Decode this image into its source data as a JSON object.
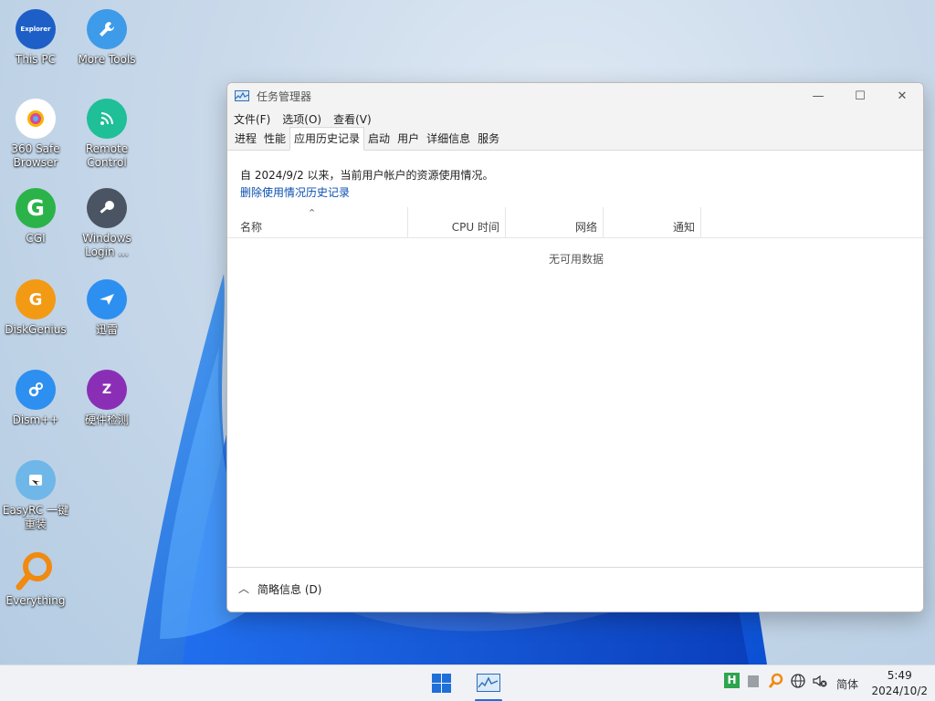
{
  "desktop": {
    "icons": [
      {
        "label": "This PC",
        "badge": "Explorer"
      },
      {
        "label": "More Tools"
      },
      {
        "label": "360 Safe Browser"
      },
      {
        "label": "Remote Control"
      },
      {
        "label": "CGI",
        "glyph": "G"
      },
      {
        "label": "Windows Login ...",
        "glyph": ""
      },
      {
        "label": "DiskGenius",
        "glyph": "G"
      },
      {
        "label": "迅雷"
      },
      {
        "label": "Dism++"
      },
      {
        "label": "硬件检测",
        "glyph": "Z"
      },
      {
        "label": "EasyRC 一键重装"
      },
      {
        "label": "Everything"
      }
    ]
  },
  "window": {
    "title": "任务管理器",
    "menu": [
      "文件(F)",
      "选项(O)",
      "查看(V)"
    ],
    "tabs": [
      "进程",
      "性能",
      "应用历史记录",
      "启动",
      "用户",
      "详细信息",
      "服务"
    ],
    "active_tab_index": 2,
    "info_text": "自 2024/9/2 以来，当前用户帐户的资源使用情况。",
    "delete_link": "删除使用情况历史记录",
    "columns": [
      "名称",
      "CPU 时间",
      "网络",
      "通知"
    ],
    "empty_text": "无可用数据",
    "footer_label": "简略信息 (D)"
  },
  "taskbar": {
    "ime_label": "简体",
    "time": "5:49",
    "date": "2024/10/2",
    "tray_h": "H"
  },
  "colors": {
    "accent": "#1e6fd9",
    "link": "#0a4fb0"
  }
}
